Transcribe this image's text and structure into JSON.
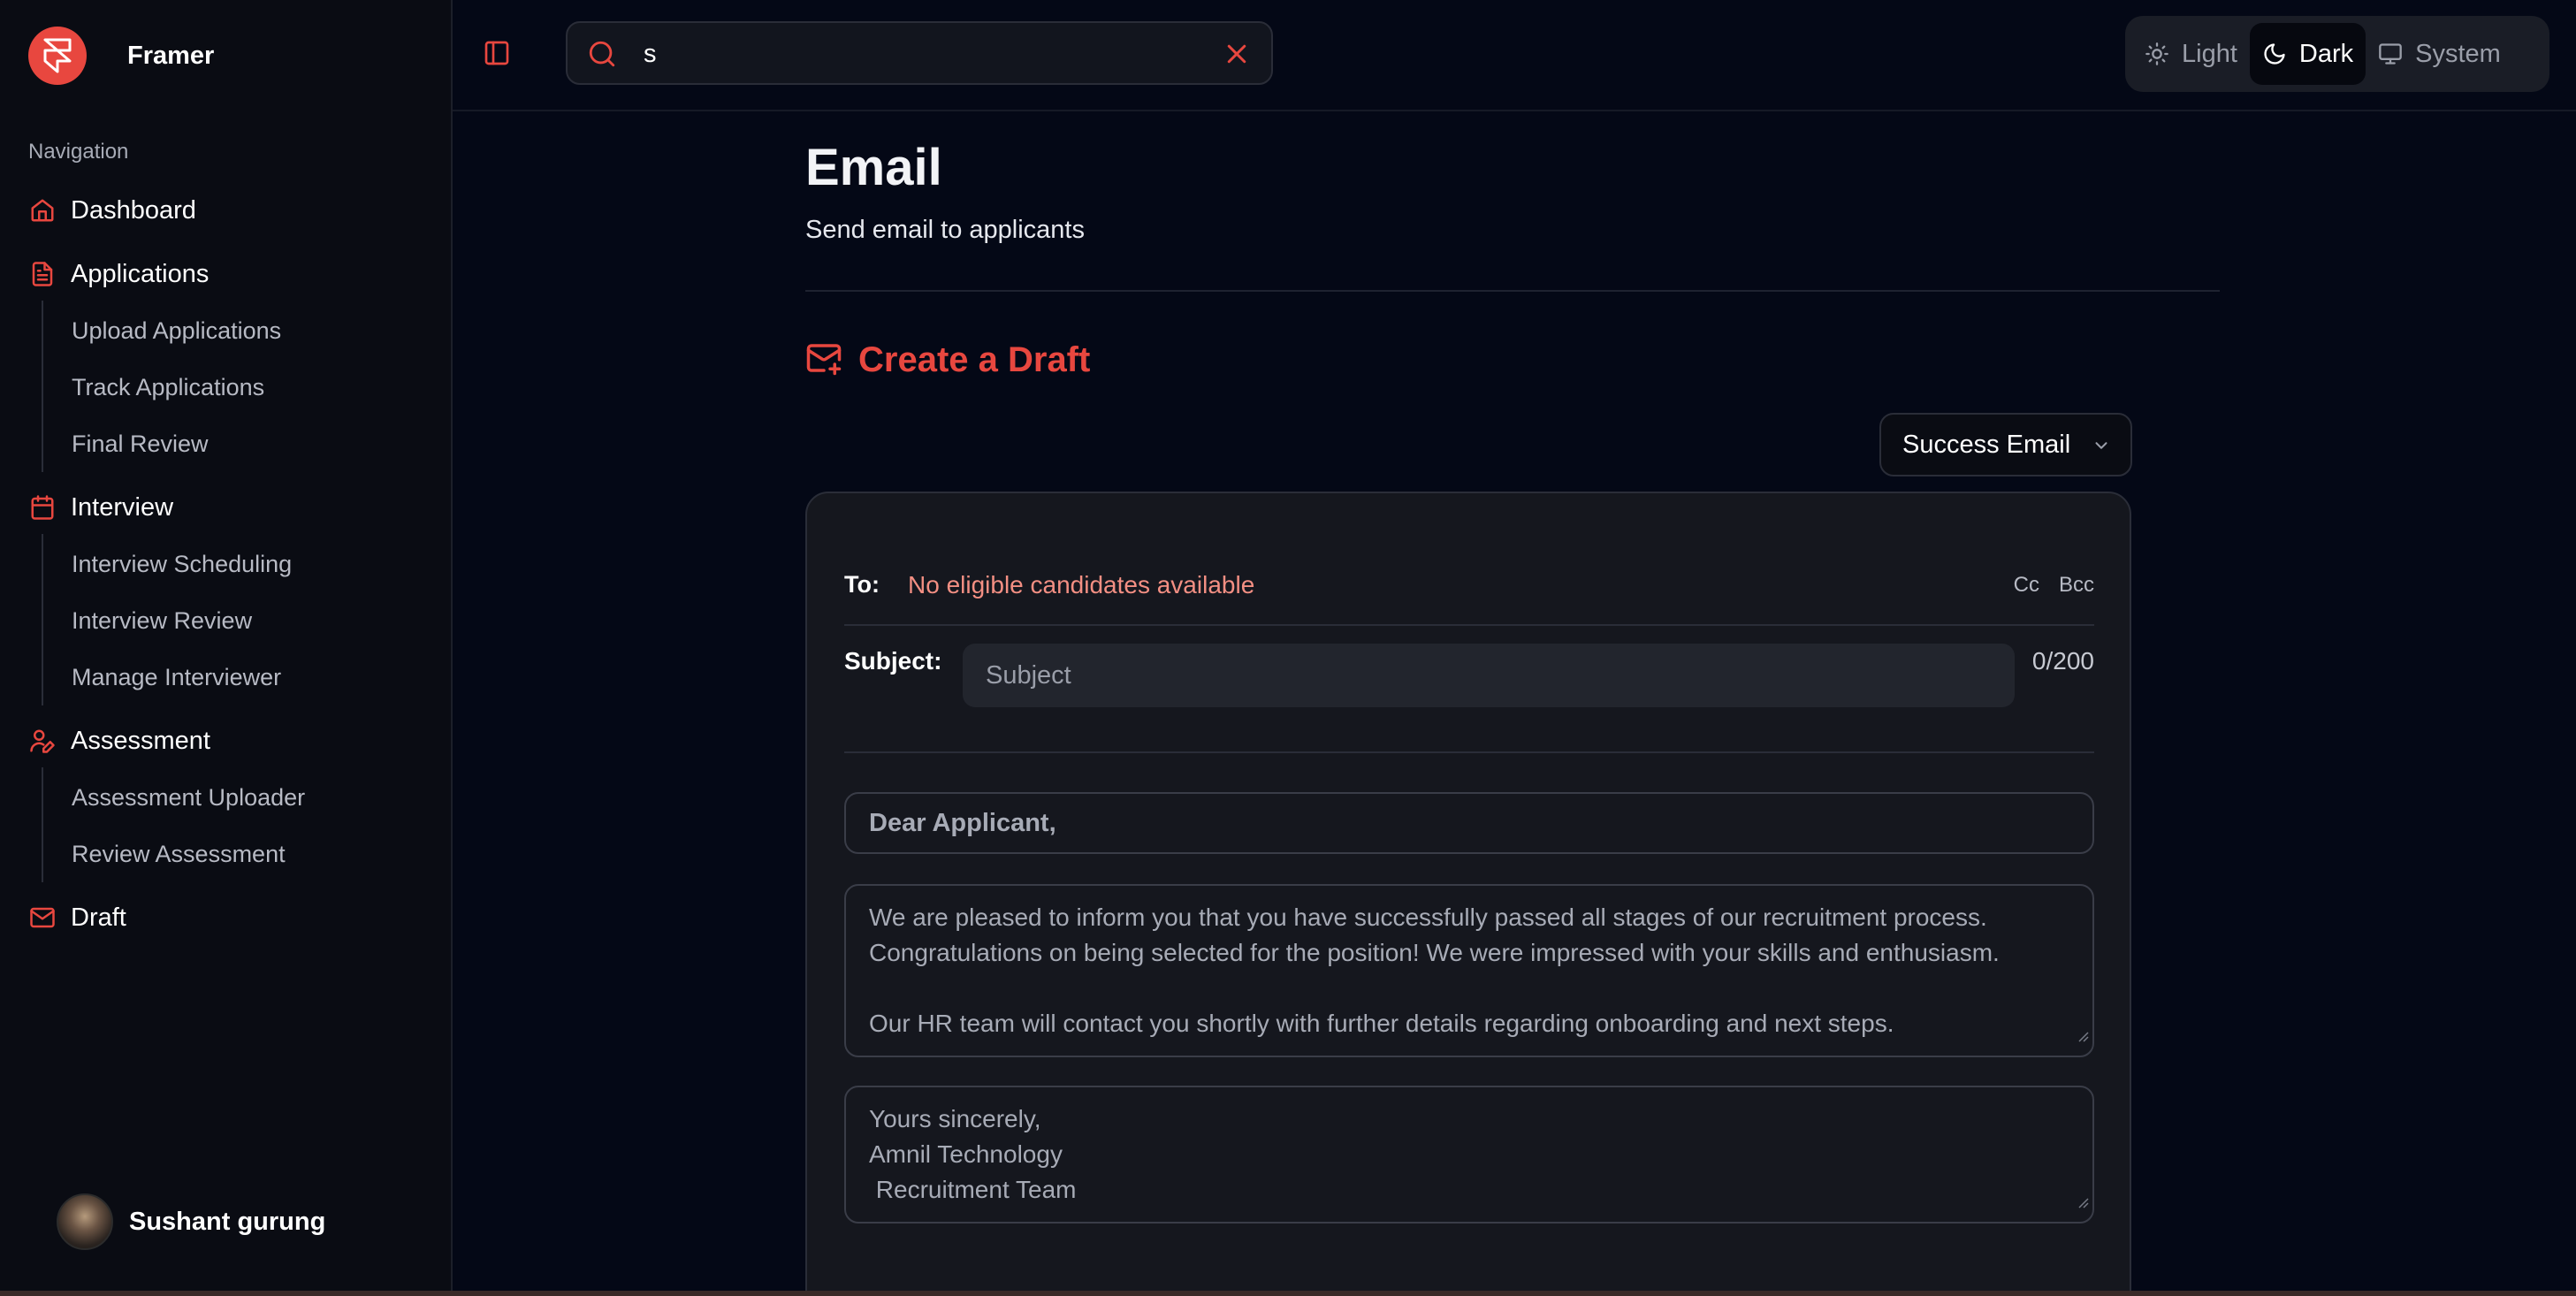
{
  "brand": {
    "name": "Framer",
    "accent": "#e8473f"
  },
  "sidebar": {
    "heading": "Navigation",
    "items": [
      {
        "label": "Dashboard",
        "icon": "home-icon"
      },
      {
        "label": "Applications",
        "icon": "file-text-icon",
        "children": [
          "Upload Applications",
          "Track Applications",
          "Final Review"
        ]
      },
      {
        "label": "Interview",
        "icon": "calendar-icon",
        "children": [
          "Interview Scheduling",
          "Interview Review",
          "Manage Interviewer"
        ]
      },
      {
        "label": "Assessment",
        "icon": "user-pen-icon",
        "children": [
          "Assessment Uploader",
          "Review Assessment"
        ]
      },
      {
        "label": "Draft",
        "icon": "mail-icon"
      }
    ],
    "user": {
      "name": "Sushant gurung"
    }
  },
  "topbar": {
    "search": {
      "value": "s"
    },
    "theme": {
      "options": [
        "Light",
        "Dark",
        "System"
      ],
      "selected": "Dark"
    }
  },
  "page": {
    "title": "Email",
    "subtitle": "Send email to applicants",
    "section_title": "Create a Draft",
    "template": "Success Email"
  },
  "email": {
    "to_label": "To:",
    "to_value": "No eligible candidates available",
    "cc": "Cc",
    "bcc": "Bcc",
    "subject_label": "Subject:",
    "subject_placeholder": "Subject",
    "subject_count": "0/200",
    "greeting": "Dear Applicant,",
    "body_line1": "We are pleased to inform you that you have successfully passed all stages of our recruitment process.",
    "body_line2": "Congratulations on being selected for the position! We were impressed with your skills and enthusiasm.",
    "body_line3": "Our HR team will contact you shortly with further details regarding onboarding and next steps.",
    "signature": "Yours sincerely,\nAmnil Technology\n Recruitment Team"
  }
}
